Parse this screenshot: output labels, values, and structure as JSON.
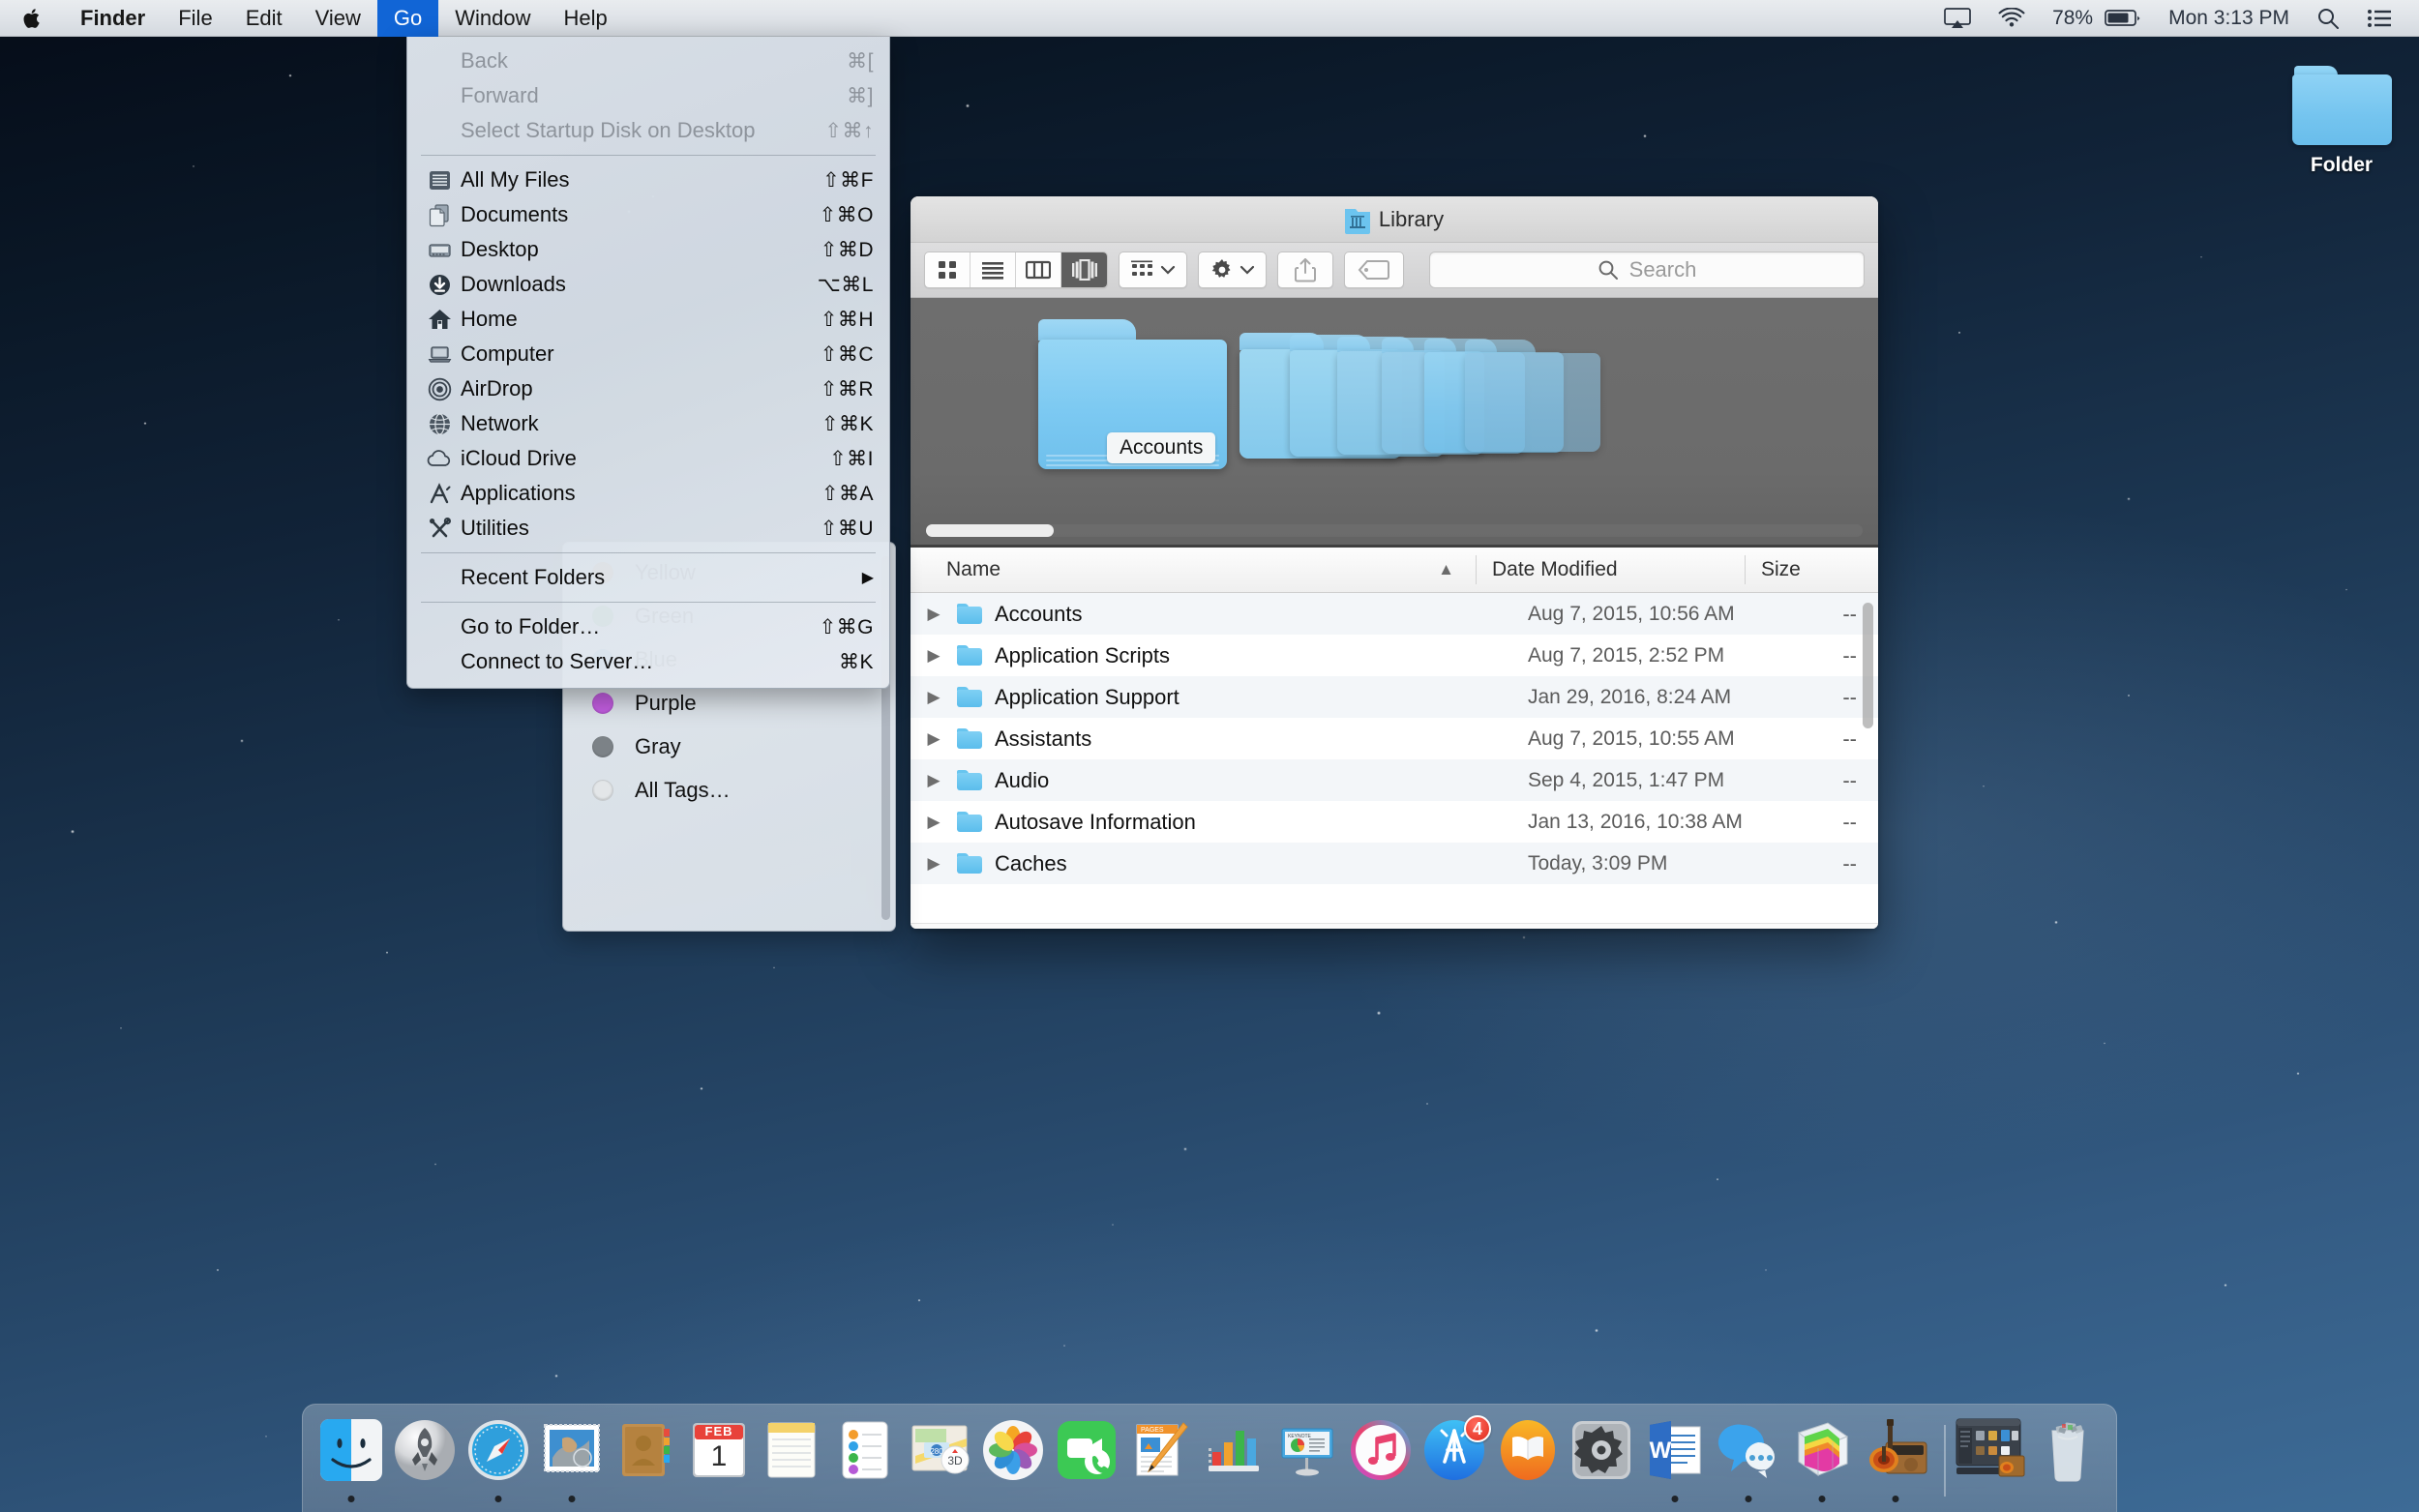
{
  "menubar": {
    "apple_icon": "apple-logo-icon",
    "items": [
      "Finder",
      "File",
      "Edit",
      "View",
      "Go",
      "Window",
      "Help"
    ],
    "active_item": "Go",
    "status": {
      "airplay_icon": "airplay-icon",
      "wifi_icon": "wifi-icon",
      "battery_percent": "78%",
      "battery_icon": "battery-icon",
      "clock": "Mon 3:13 PM",
      "spotlight_icon": "search-icon",
      "notification_center_icon": "list-icon"
    }
  },
  "go_menu": {
    "groups": [
      [
        {
          "label": "Back",
          "shortcut": "⌘[",
          "icon": "",
          "disabled": true
        },
        {
          "label": "Forward",
          "shortcut": "⌘]",
          "icon": "",
          "disabled": true
        },
        {
          "label": "Select Startup Disk on Desktop",
          "shortcut": "⇧⌘↑",
          "icon": "",
          "disabled": true
        }
      ],
      [
        {
          "label": "All My Files",
          "shortcut": "⇧⌘F",
          "icon": "all-my-files-icon",
          "disabled": false
        },
        {
          "label": "Documents",
          "shortcut": "⇧⌘O",
          "icon": "documents-icon",
          "disabled": false
        },
        {
          "label": "Desktop",
          "shortcut": "⇧⌘D",
          "icon": "desktop-icon",
          "disabled": false
        },
        {
          "label": "Downloads",
          "shortcut": "⌥⌘L",
          "icon": "downloads-icon",
          "disabled": false
        },
        {
          "label": "Home",
          "shortcut": "⇧⌘H",
          "icon": "home-icon",
          "disabled": false
        },
        {
          "label": "Computer",
          "shortcut": "⇧⌘C",
          "icon": "computer-icon",
          "disabled": false
        },
        {
          "label": "AirDrop",
          "shortcut": "⇧⌘R",
          "icon": "airdrop-icon",
          "disabled": false
        },
        {
          "label": "Network",
          "shortcut": "⇧⌘K",
          "icon": "network-icon",
          "disabled": false
        },
        {
          "label": "iCloud Drive",
          "shortcut": "⇧⌘I",
          "icon": "icloud-icon",
          "disabled": false
        },
        {
          "label": "Applications",
          "shortcut": "⇧⌘A",
          "icon": "applications-icon",
          "disabled": false
        },
        {
          "label": "Utilities",
          "shortcut": "⇧⌘U",
          "icon": "utilities-icon",
          "disabled": false
        }
      ],
      [
        {
          "label": "Recent Folders",
          "shortcut": "▶",
          "icon": "",
          "disabled": false,
          "submenu": true
        }
      ],
      [
        {
          "label": "Go to Folder…",
          "shortcut": "⇧⌘G",
          "icon": "",
          "disabled": false
        },
        {
          "label": "Connect to Server…",
          "shortcut": "⌘K",
          "icon": "",
          "disabled": false
        }
      ]
    ]
  },
  "tags_menu": {
    "items": [
      {
        "label": "Yellow",
        "color": "#e8a33d"
      },
      {
        "label": "Green",
        "color": "#3cb54a"
      },
      {
        "label": "Blue",
        "color": "#2196e3"
      },
      {
        "label": "Purple",
        "color": "#c25de0"
      },
      {
        "label": "Gray",
        "color": "#7c8287"
      },
      {
        "label": "All Tags…",
        "color": "#e3e6e8"
      }
    ]
  },
  "finder": {
    "title": "Library",
    "title_icon": "library-folder-icon",
    "toolbar": {
      "view_buttons": [
        {
          "name": "icon-view-button",
          "icon": "grid-icon",
          "selected": false
        },
        {
          "name": "list-view-button",
          "icon": "list-icon",
          "selected": false
        },
        {
          "name": "column-view-button",
          "icon": "columns-icon",
          "selected": false
        },
        {
          "name": "coverflow-view-button",
          "icon": "coverflow-icon",
          "selected": true
        }
      ],
      "arrange_button": {
        "icon": "arrange-icon",
        "chevron": "chevron-down-icon"
      },
      "action_button": {
        "icon": "gear-icon",
        "chevron": "chevron-down-icon"
      },
      "share_button": {
        "icon": "share-icon"
      },
      "tags_button": {
        "icon": "tag-icon"
      },
      "search_placeholder": "Search",
      "search_value": "",
      "search_icon": "search-icon"
    },
    "coverflow": {
      "selected_label": "Accounts",
      "folder_count": 7
    },
    "columns": [
      {
        "label": "Name",
        "sort": "⌃",
        "sorted": true
      },
      {
        "label": "Date Modified",
        "sort": "",
        "sorted": false
      },
      {
        "label": "Size",
        "sort": "",
        "sorted": false
      }
    ],
    "rows": [
      {
        "name": "Accounts",
        "date": "Aug 7, 2015, 10:56 AM",
        "size": "--",
        "selected": false
      },
      {
        "name": "Application Scripts",
        "date": "Aug 7, 2015, 2:52 PM",
        "size": "--",
        "selected": false
      },
      {
        "name": "Application Support",
        "date": "Jan 29, 2016, 8:24 AM",
        "size": "--",
        "selected": false
      },
      {
        "name": "Assistants",
        "date": "Aug 7, 2015, 10:55 AM",
        "size": "--",
        "selected": false
      },
      {
        "name": "Audio",
        "date": "Sep 4, 2015, 1:47 PM",
        "size": "--",
        "selected": false
      },
      {
        "name": "Autosave Information",
        "date": "Jan 13, 2016, 10:38 AM",
        "size": "--",
        "selected": false
      },
      {
        "name": "Caches",
        "date": "Today, 3:09 PM",
        "size": "--",
        "selected": false
      }
    ]
  },
  "desktop": {
    "folder": {
      "label": "Folder",
      "icon": "folder-icon"
    }
  },
  "dock": {
    "items": [
      {
        "name": "finder",
        "label": "Finder",
        "running": true
      },
      {
        "name": "launchpad",
        "label": "Launchpad",
        "running": false
      },
      {
        "name": "safari",
        "label": "Safari",
        "running": true
      },
      {
        "name": "mail",
        "label": "Mail",
        "running": true
      },
      {
        "name": "contacts",
        "label": "Contacts",
        "running": false
      },
      {
        "name": "calendar",
        "label": "Calendar",
        "running": false,
        "month": "FEB",
        "day": "1"
      },
      {
        "name": "notes",
        "label": "Notes",
        "running": false
      },
      {
        "name": "reminders",
        "label": "Reminders",
        "running": false
      },
      {
        "name": "maps",
        "label": "Maps",
        "running": false
      },
      {
        "name": "photos",
        "label": "Photos",
        "running": false
      },
      {
        "name": "facetime",
        "label": "FaceTime",
        "running": false
      },
      {
        "name": "pages",
        "label": "Pages",
        "running": false
      },
      {
        "name": "numbers",
        "label": "Numbers",
        "running": false
      },
      {
        "name": "keynote",
        "label": "Keynote",
        "running": false
      },
      {
        "name": "itunes",
        "label": "iTunes",
        "running": false
      },
      {
        "name": "app-store",
        "label": "App Store",
        "running": false,
        "badge": "4"
      },
      {
        "name": "ibooks",
        "label": "iBooks",
        "running": false
      },
      {
        "name": "system-preferences",
        "label": "System Preferences",
        "running": false
      },
      {
        "name": "microsoft-word",
        "label": "Microsoft Word",
        "running": true
      },
      {
        "name": "messages",
        "label": "Messages",
        "running": true
      },
      {
        "name": "grapher",
        "label": "Grapher",
        "running": true
      },
      {
        "name": "garageband",
        "label": "GarageBand",
        "running": true
      }
    ],
    "minimized": [
      {
        "name": "finder-window-minimized",
        "label": "Finder window"
      }
    ],
    "trash": {
      "name": "trash",
      "label": "Trash"
    }
  }
}
